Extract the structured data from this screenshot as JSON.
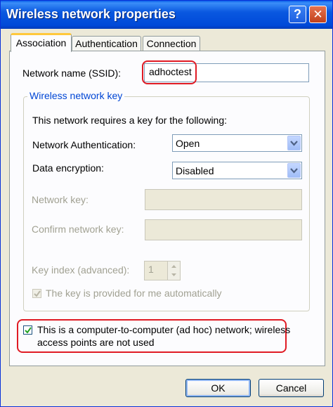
{
  "window": {
    "title": "Wireless network properties",
    "help_glyph": "?",
    "close_glyph": "✕"
  },
  "tabs": [
    {
      "label": "Association",
      "active": true
    },
    {
      "label": "Authentication",
      "active": false
    },
    {
      "label": "Connection",
      "active": false
    }
  ],
  "association": {
    "ssid_label": "Network name (SSID):",
    "ssid_value": "adhoctest",
    "key_group_title": "Wireless network key",
    "key_required_text": "This network requires a key for the following:",
    "auth_label": "Network Authentication:",
    "auth_value": "Open",
    "encryption_label": "Data encryption:",
    "encryption_value": "Disabled",
    "network_key_label": "Network key:",
    "network_key_value": "",
    "confirm_key_label": "Confirm network key:",
    "confirm_key_value": "",
    "key_index_label": "Key index (advanced):",
    "key_index_value": "1",
    "key_provided_label": "The key is provided for me automatically",
    "key_provided_checked": true,
    "adhoc_label_line1": "This is a computer-to-computer (ad hoc) network; wireless",
    "adhoc_label_line2": "access points are not used",
    "adhoc_checked": true
  },
  "buttons": {
    "ok_label": "OK",
    "cancel_label": "Cancel"
  },
  "colors": {
    "titlebar": "#0a58e0",
    "highlight_outline": "#e01b24",
    "group_title": "#0046d5"
  }
}
